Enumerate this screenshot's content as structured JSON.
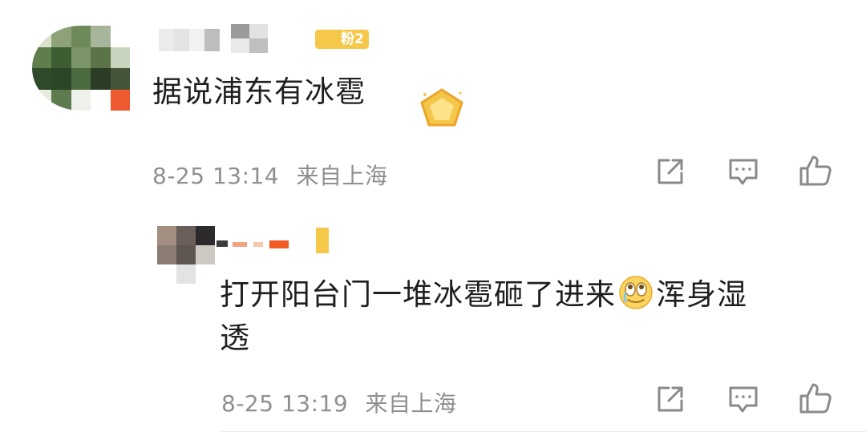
{
  "comments": [
    {
      "badge": "粉2",
      "text": "据说浦东有冰雹",
      "time": "8-25 13:14",
      "location": "来自上海"
    }
  ],
  "replies": [
    {
      "text_line1": "打开阳台门一堆冰雹砸了进来",
      "text_after_emoji": "浑身湿",
      "text_line2": "透",
      "emoji": "smiling-tear-emoji",
      "time": "8-25 13:19",
      "location": "来自上海"
    }
  ],
  "actions": {
    "share_icon": "share-icon",
    "comment_icon": "comment-icon",
    "like_icon": "thumbs-up-icon"
  },
  "colors": {
    "text": "#1f1f1f",
    "meta": "#8f8f8f",
    "badge": "#f6c84a",
    "accent_orange": "#f05a24"
  }
}
